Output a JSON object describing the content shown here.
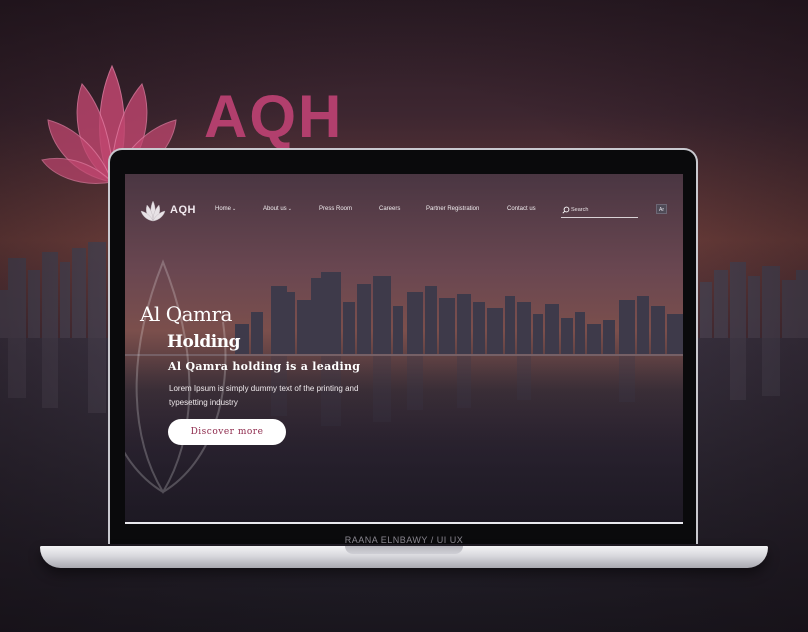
{
  "background": {
    "brand_text": "AQH",
    "brand_color": "#b23f6d",
    "logo_icon": "lotus-icon"
  },
  "nav": {
    "brand": "AQH",
    "items": [
      {
        "label": "Home",
        "has_dropdown": true
      },
      {
        "label": "About us",
        "has_dropdown": true
      },
      {
        "label": "Press Room",
        "has_dropdown": false
      },
      {
        "label": "Careers",
        "has_dropdown": false
      },
      {
        "label": "Partner Registration",
        "has_dropdown": false
      },
      {
        "label": "Contact us",
        "has_dropdown": false
      }
    ],
    "dropdown_glyph": "⌄",
    "search_placeholder": "Search",
    "search_icon": "search-icon",
    "language": "Ar"
  },
  "hero": {
    "title_line1": "Al Qamra",
    "title_line2": "Holding",
    "subtitle": "Al Qamra holding is a leading",
    "description": "Lorem Ipsum is simply dummy text of the printing and typesetting industry",
    "cta_label": "Discover more"
  },
  "credit": "RAANA ELNBAWY / UI UX",
  "colors": {
    "accent": "#b23f6d",
    "cta_text": "#8e2a4c"
  }
}
